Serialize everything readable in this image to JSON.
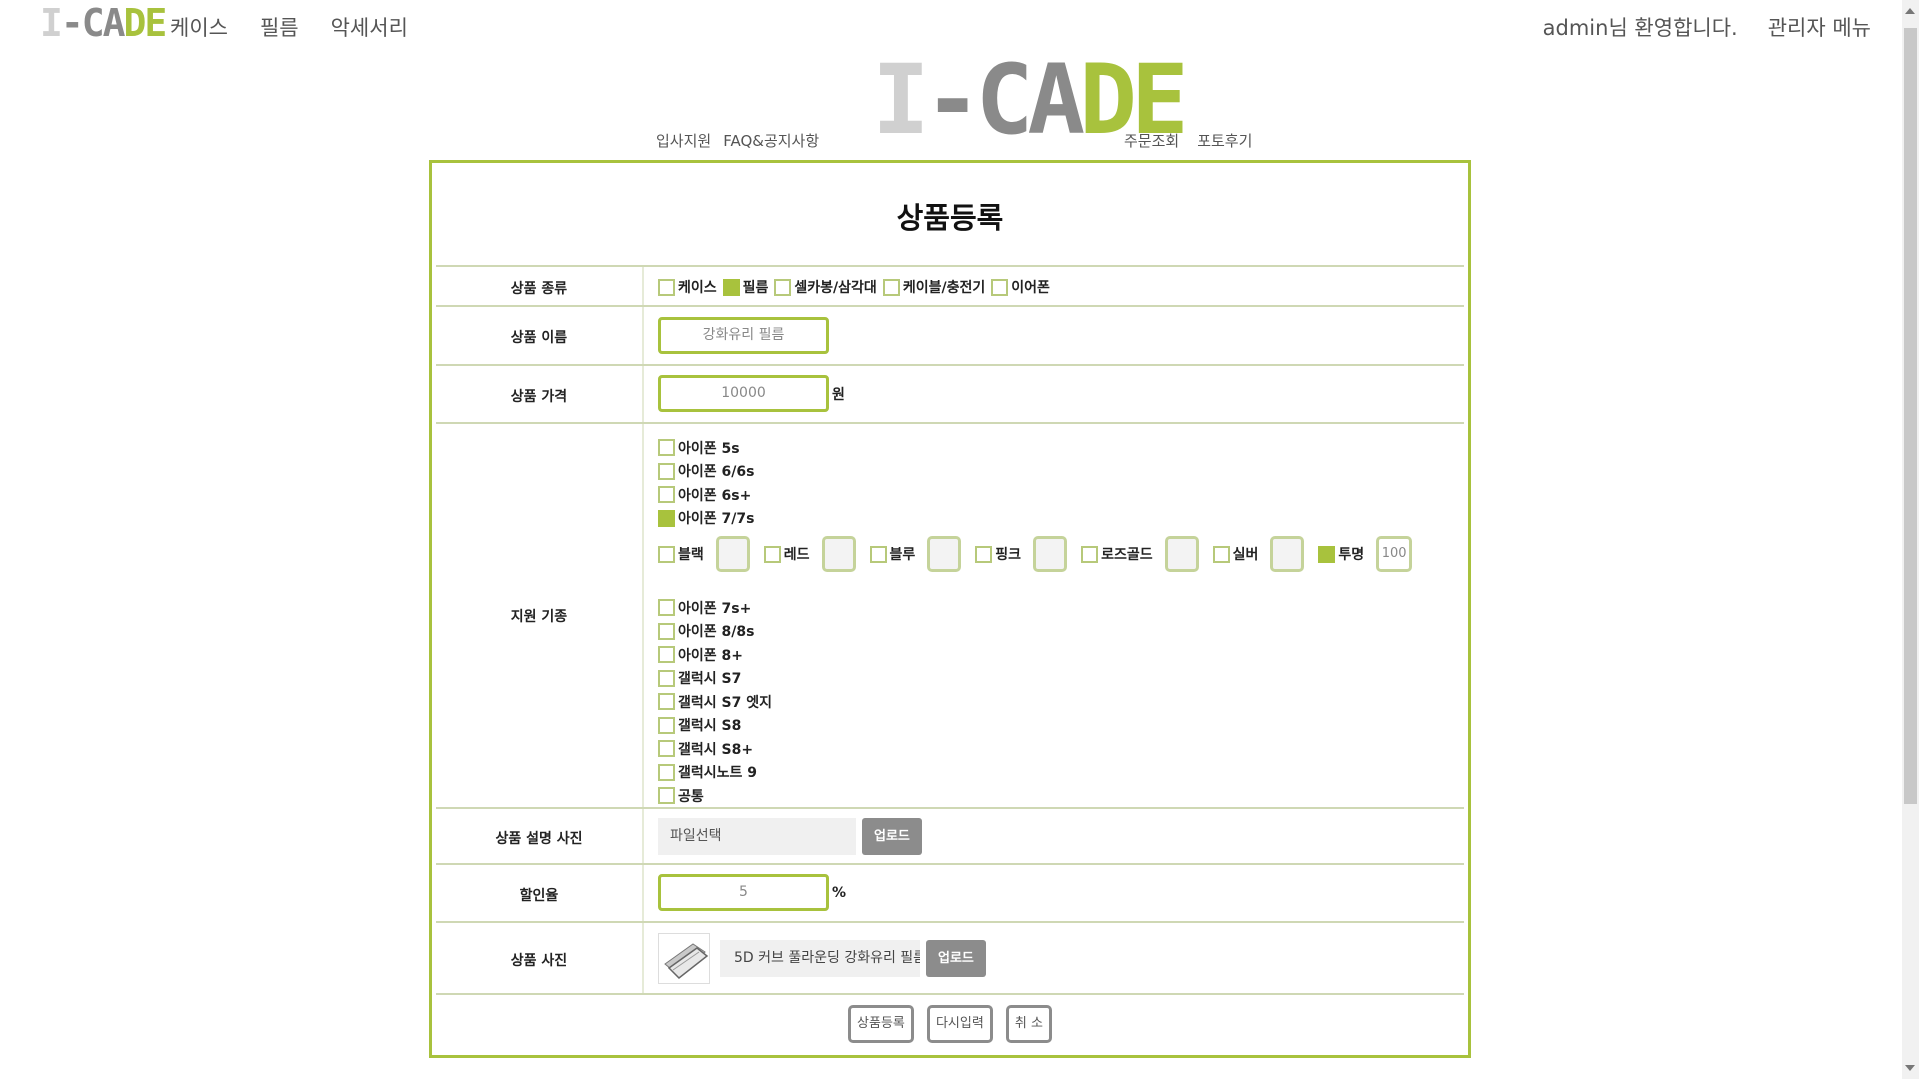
{
  "brand": {
    "logo_part1": "I",
    "logo_part2": "-CA",
    "logo_part3": "DE",
    "green": "#a8c23d",
    "gray": "#8a8a8a"
  },
  "top_nav": {
    "items": [
      "케이스",
      "필름",
      "악세서리"
    ]
  },
  "user": {
    "welcome": "admin님 환영합니다.",
    "admin_menu": "관리자 메뉴"
  },
  "sub_nav": {
    "left": [
      "입사지원",
      "FAQ&공지사항"
    ],
    "right": [
      "주문조회",
      "포토후기"
    ]
  },
  "form": {
    "title": "상품등록",
    "category": {
      "label": "상품 종류",
      "options": [
        {
          "label": "케이스",
          "checked": false
        },
        {
          "label": "필름",
          "checked": true
        },
        {
          "label": "셀카봉/삼각대",
          "checked": false
        },
        {
          "label": "케이블/충전기",
          "checked": false
        },
        {
          "label": "이어폰",
          "checked": false
        }
      ]
    },
    "name": {
      "label": "상품 이름",
      "value": "강화유리 필름"
    },
    "price": {
      "label": "상품 가격",
      "value": "10000",
      "unit": "원"
    },
    "models": {
      "label": "지원 기종",
      "group1": [
        {
          "label": "아이폰 5s",
          "checked": false
        },
        {
          "label": "아이폰 6/6s",
          "checked": false
        },
        {
          "label": "아이폰 6s+",
          "checked": false
        },
        {
          "label": "아이폰 7/7s",
          "checked": true
        }
      ],
      "colors": [
        {
          "label": "블랙",
          "checked": false,
          "value": ""
        },
        {
          "label": "레드",
          "checked": false,
          "value": ""
        },
        {
          "label": "블루",
          "checked": false,
          "value": ""
        },
        {
          "label": "핑크",
          "checked": false,
          "value": ""
        },
        {
          "label": "로즈골드",
          "checked": false,
          "value": ""
        },
        {
          "label": "실버",
          "checked": false,
          "value": ""
        },
        {
          "label": "투명",
          "checked": true,
          "value": "100"
        }
      ],
      "group2": [
        {
          "label": "아이폰 7s+",
          "checked": false
        },
        {
          "label": "아이폰 8/8s",
          "checked": false
        },
        {
          "label": "아이폰 8+",
          "checked": false
        },
        {
          "label": "갤럭시 S7",
          "checked": false
        },
        {
          "label": "갤럭시 S7 엣지",
          "checked": false
        },
        {
          "label": "갤럭시 S8",
          "checked": false
        },
        {
          "label": "갤럭시 S8+",
          "checked": false
        },
        {
          "label": "갤럭시노트 9",
          "checked": false
        },
        {
          "label": "공통",
          "checked": false
        }
      ]
    },
    "desc_photo": {
      "label": "상품 설명 사진",
      "file_placeholder": "파일선택",
      "upload": "업로드"
    },
    "discount": {
      "label": "할인율",
      "value": "5",
      "unit": "%"
    },
    "photo": {
      "label": "상품 사진",
      "file_name": "5D 커브 풀라운딩 강화유리 필름",
      "upload": "업로드"
    },
    "buttons": {
      "submit": "상품등록",
      "reset": "다시입력",
      "cancel": "취 소"
    }
  }
}
